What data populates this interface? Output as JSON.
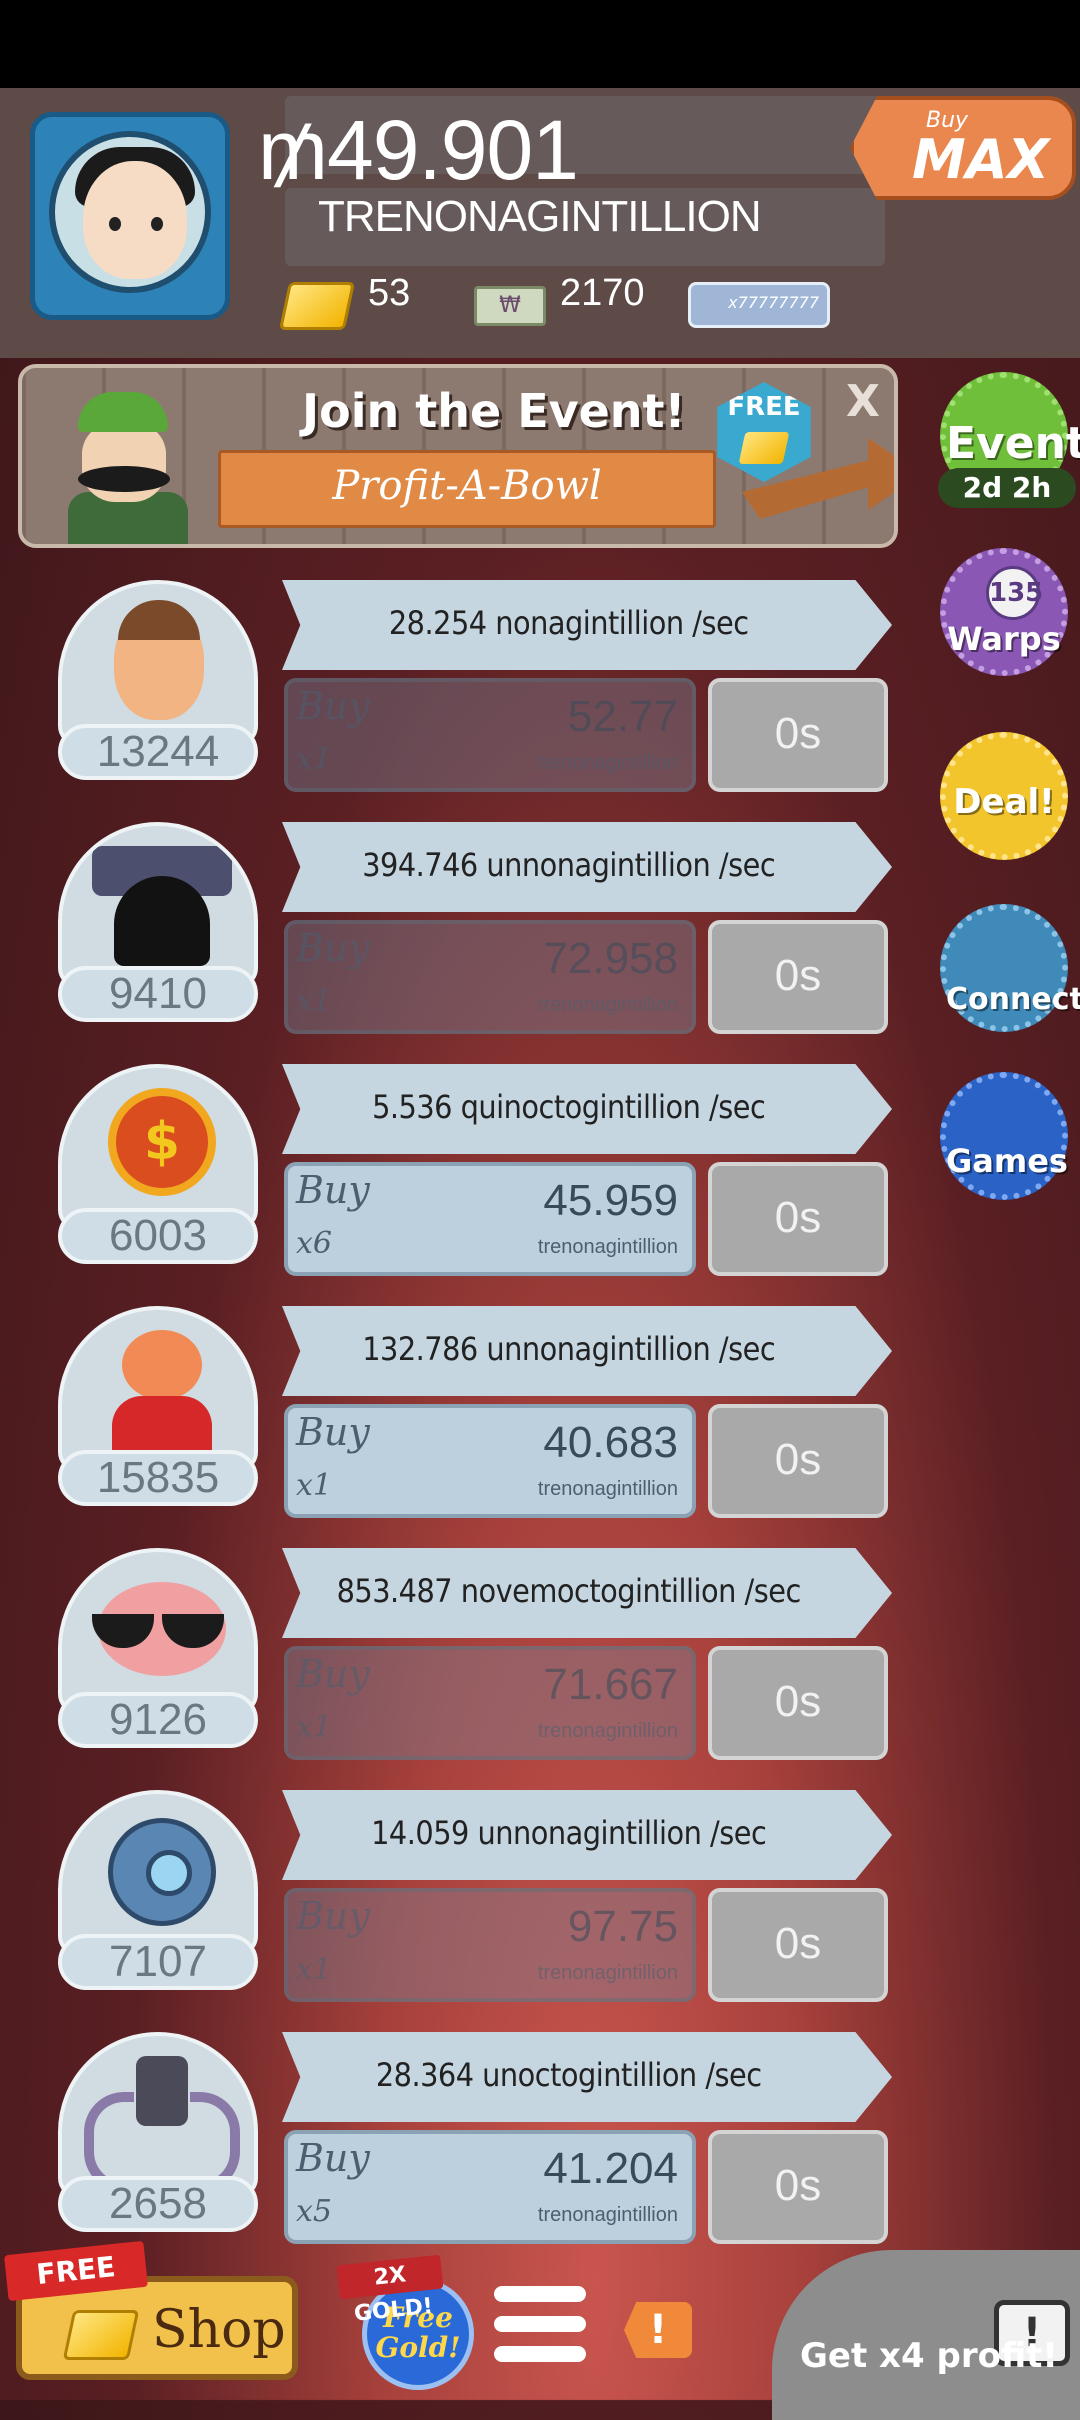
{
  "header": {
    "money_amount": "₥49.901",
    "money_unit": "TRENONAGINTILLION",
    "gold_count": "53",
    "megabucks_count": "2170",
    "megaticket_text": "x77777777",
    "buy_max": {
      "top": "Buy",
      "main": "MAX"
    }
  },
  "event_banner": {
    "title": "Join the Event!",
    "subtitle": "Profit-A-Bowl",
    "free_badge": "FREE",
    "close": "X"
  },
  "side_buttons": {
    "event": {
      "label": "Event",
      "timer": "2d 2h"
    },
    "warps": {
      "label": "Warps",
      "count": "135"
    },
    "deal": {
      "label": "Deal!"
    },
    "connect": {
      "label": "Connect"
    },
    "games": {
      "label": "Games"
    }
  },
  "investments": [
    {
      "name": "farmer",
      "count": "13244",
      "rate": "28.254 nonagintillion /sec",
      "buy_label": "Buy",
      "multiplier": "x1",
      "cost": "52.77",
      "cost_unit": "trenonagintillion",
      "timer": "0s",
      "affordable": false
    },
    {
      "name": "bat-creature",
      "count": "9410",
      "rate": "394.746 unnonagintillion /sec",
      "buy_label": "Buy",
      "multiplier": "x1",
      "cost": "72.958",
      "cost_unit": "trenonagintillion",
      "timer": "0s",
      "affordable": false
    },
    {
      "name": "coin-sun",
      "count": "6003",
      "rate": "5.536 quinoctogintillion /sec",
      "buy_label": "Buy",
      "multiplier": "x6",
      "cost": "45.959",
      "cost_unit": "trenonagintillion",
      "timer": "0s",
      "affordable": true
    },
    {
      "name": "bear-robe",
      "count": "15835",
      "rate": "132.786 unnonagintillion /sec",
      "buy_label": "Buy",
      "multiplier": "x1",
      "cost": "40.683",
      "cost_unit": "trenonagintillion",
      "timer": "0s",
      "affordable": true
    },
    {
      "name": "brain-glasses",
      "count": "9126",
      "rate": "853.487 novemoctogintillion /sec",
      "buy_label": "Buy",
      "multiplier": "x1",
      "cost": "71.667",
      "cost_unit": "trenonagintillion",
      "timer": "0s",
      "affordable": false
    },
    {
      "name": "robot-orb",
      "count": "7107",
      "rate": "14.059 unnonagintillion /sec",
      "buy_label": "Buy",
      "multiplier": "x1",
      "cost": "97.75",
      "cost_unit": "trenonagintillion",
      "timer": "0s",
      "affordable": false
    },
    {
      "name": "spider-bot",
      "count": "2658",
      "rate": "28.364 unoctogintillion /sec",
      "buy_label": "Buy",
      "multiplier": "x5",
      "cost": "41.204",
      "cost_unit": "trenonagintillion",
      "timer": "0s",
      "affordable": true
    }
  ],
  "bottom_bar": {
    "shop_free_tag": "FREE",
    "shop_label": "Shop",
    "gold_tag": "2X GOLD!",
    "free_gold": "Free Gold!",
    "alert": "!",
    "profit": "Get x4 profit!"
  }
}
